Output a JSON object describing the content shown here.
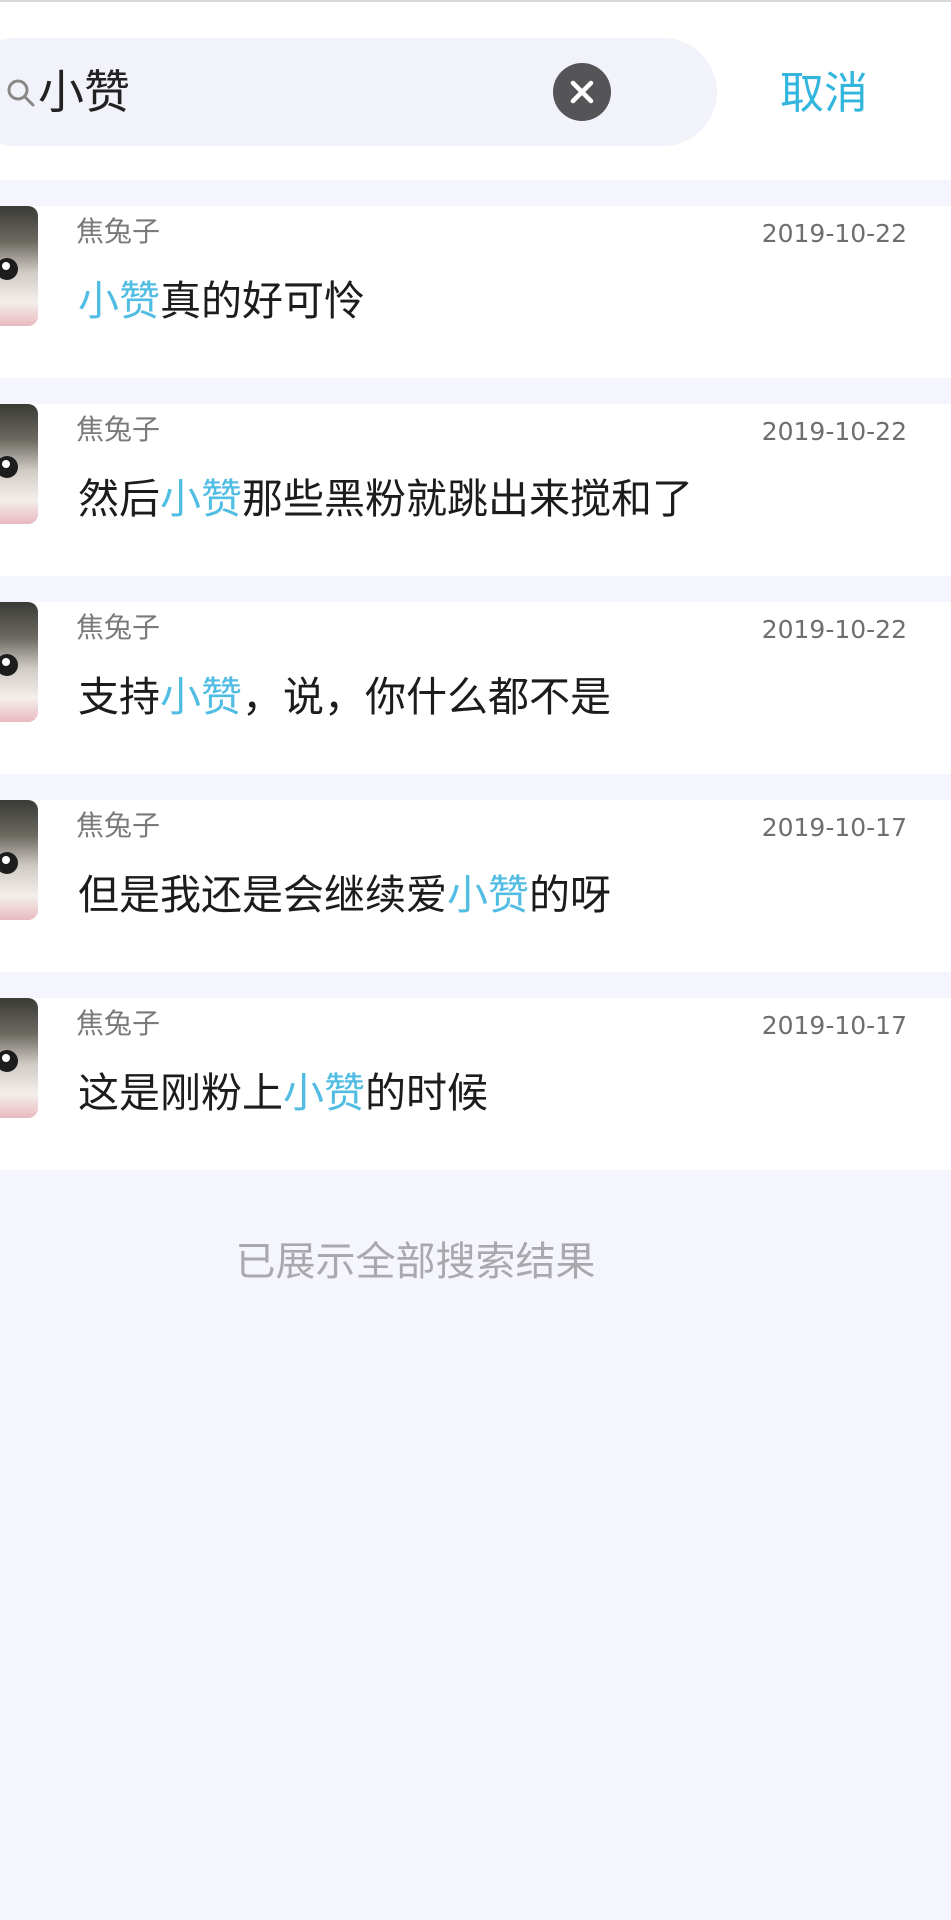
{
  "search": {
    "query": "小赞",
    "cancel_label": "取消"
  },
  "results": [
    {
      "name": "焦兔子",
      "date": "2019-10-22",
      "before": "",
      "keyword": "小赞",
      "after": "真的好可怜"
    },
    {
      "name": "焦兔子",
      "date": "2019-10-22",
      "before": "然后",
      "keyword": "小赞",
      "after": "那些黑粉就跳出来搅和了"
    },
    {
      "name": "焦兔子",
      "date": "2019-10-22",
      "before": "支持",
      "keyword": "小赞",
      "after": "，说，你什么都不是"
    },
    {
      "name": "焦兔子",
      "date": "2019-10-17",
      "before": "但是我还是会继续爱",
      "keyword": "小赞",
      "after": "的呀"
    },
    {
      "name": "焦兔子",
      "date": "2019-10-17",
      "before": "这是刚粉上",
      "keyword": "小赞",
      "after": "的时候"
    }
  ],
  "footer": {
    "message": "已展示全部搜索结果"
  },
  "colors": {
    "accent": "#52bde3",
    "background": "#f5f6fd"
  }
}
